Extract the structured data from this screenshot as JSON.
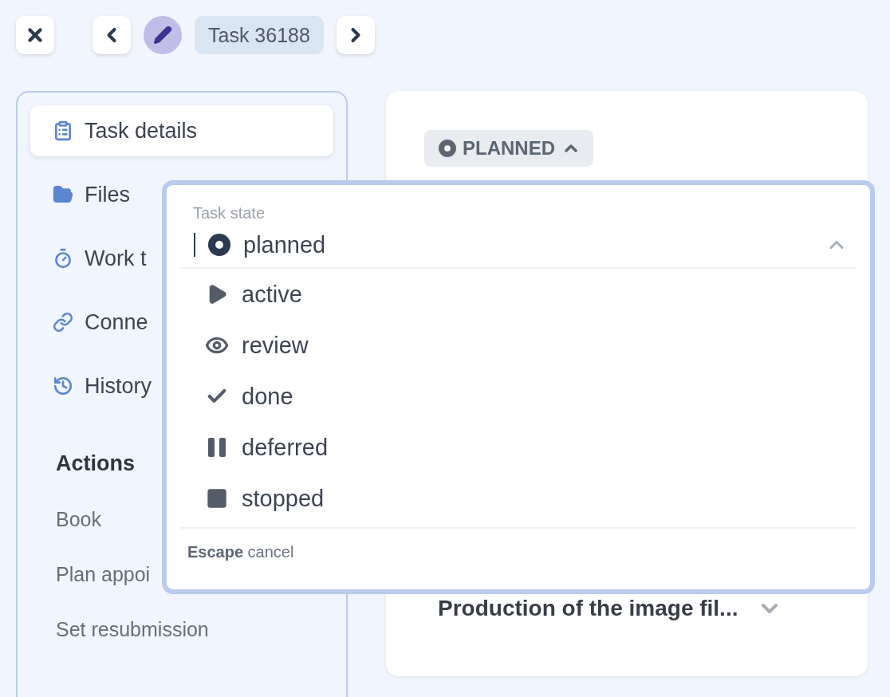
{
  "top_bar": {
    "task_label": "Task 36188"
  },
  "sidebar": {
    "items": [
      {
        "label": "Task details",
        "kind": "details",
        "selected": true
      },
      {
        "label": "Files",
        "kind": "files",
        "selected": false
      },
      {
        "label": "Work t",
        "kind": "time",
        "selected": false
      },
      {
        "label": "Conne",
        "kind": "links",
        "selected": false
      },
      {
        "label": "History",
        "kind": "history",
        "selected": false
      }
    ],
    "actions_heading": "Actions",
    "actions": [
      "Book",
      "Plan appoi",
      "Set resubmission"
    ]
  },
  "card": {
    "status_chip": "PLANNED",
    "task_title": "Production of the image fil..."
  },
  "state_menu": {
    "label": "Task state",
    "value": "planned",
    "options": [
      {
        "label": "active",
        "kind": "active"
      },
      {
        "label": "review",
        "kind": "review"
      },
      {
        "label": "done",
        "kind": "done"
      },
      {
        "label": "deferred",
        "kind": "deferred"
      },
      {
        "label": "stopped",
        "kind": "stopped"
      }
    ],
    "footer": "**Escape** cancel"
  }
}
